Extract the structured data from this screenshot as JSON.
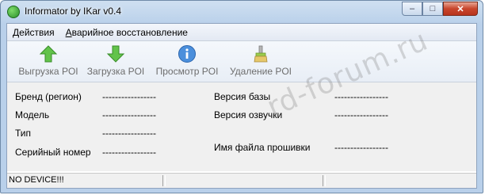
{
  "window": {
    "title": "Informator by IKar v0.4"
  },
  "menu": [
    {
      "pre": "",
      "ul": "Д",
      "post": "ействия"
    },
    {
      "pre": "",
      "ul": "А",
      "post": "варийное восстановление"
    }
  ],
  "toolbar": [
    {
      "label": "Выгрузка POI",
      "icon": "arrow-up-icon"
    },
    {
      "label": "Загрузка POI",
      "icon": "arrow-down-icon"
    },
    {
      "label": "Просмотр POI",
      "icon": "info-icon"
    },
    {
      "label": "Удаление POI",
      "icon": "brush-icon"
    }
  ],
  "fields": {
    "brand_label": "Бренд (регион)",
    "model_label": "Модель",
    "type_label": "Тип",
    "serial_label": "Серийный номер",
    "db_version_label": "Версия базы",
    "voice_version_label": "Версия озвучки",
    "firmware_file_label": "Имя файла прошивки",
    "brand_value": "-----------------",
    "model_value": "-----------------",
    "type_value": "-----------------",
    "serial_value": "-----------------",
    "db_version_value": "-----------------",
    "voice_version_value": "-----------------",
    "firmware_file_value": "-----------------"
  },
  "status": {
    "text": "NO DEVICE!!!"
  },
  "watermark": "rd-forum.ru",
  "colors": {
    "accent_green": "#3fae2a",
    "info_blue": "#3a7fd0"
  }
}
